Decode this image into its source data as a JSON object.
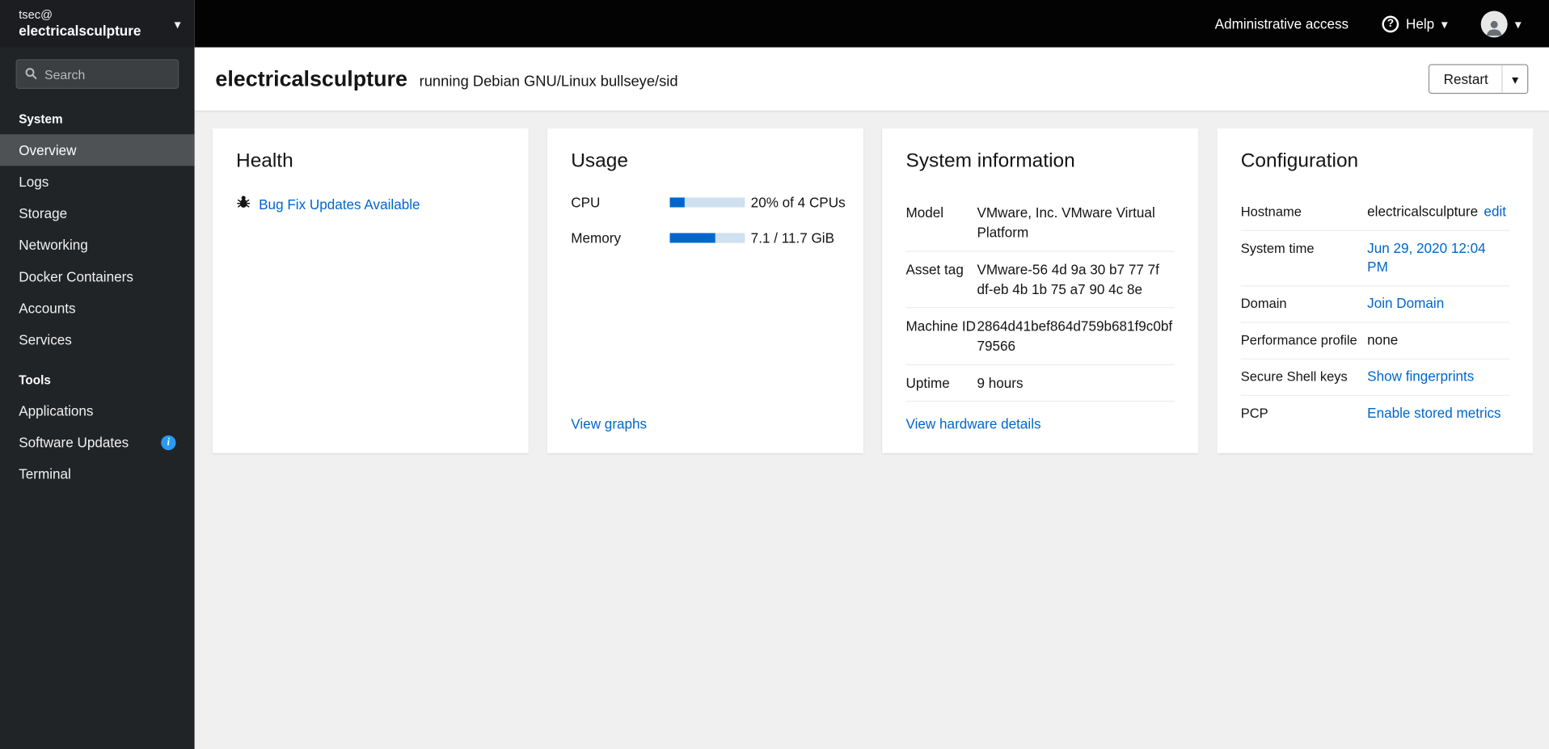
{
  "icons": {
    "caret": "▾",
    "question": "?",
    "info": "i"
  },
  "sidebar": {
    "user": "tsec@",
    "host": "electricalsculpture",
    "search_placeholder": "Search",
    "sections": [
      {
        "title": "System",
        "items": [
          {
            "label": "Overview"
          },
          {
            "label": "Logs"
          },
          {
            "label": "Storage"
          },
          {
            "label": "Networking"
          },
          {
            "label": "Docker Containers"
          },
          {
            "label": "Accounts"
          },
          {
            "label": "Services"
          }
        ]
      },
      {
        "title": "Tools",
        "items": [
          {
            "label": "Applications"
          },
          {
            "label": "Software Updates"
          },
          {
            "label": "Terminal"
          }
        ]
      }
    ]
  },
  "masthead": {
    "admin_access": "Administrative access",
    "help_label": "Help"
  },
  "header": {
    "hostname": "electricalsculpture",
    "os_text": "running Debian GNU/Linux bullseye/sid",
    "restart_label": "Restart"
  },
  "cards": {
    "health": {
      "title": "Health",
      "updates_link": "Bug Fix Updates Available"
    },
    "usage": {
      "title": "Usage",
      "cpu_label": "CPU",
      "cpu_percent": 20,
      "cpu_value": "20% of 4 CPUs",
      "memory_label": "Memory",
      "memory_percent": 61,
      "memory_value": "7.1 / 11.7 GiB",
      "view_graphs_link": "View graphs"
    },
    "system_information": {
      "title": "System information",
      "rows": [
        {
          "label": "Model",
          "value": "VMware, Inc. VMware Virtual Platform"
        },
        {
          "label": "Asset tag",
          "value": "VMware-56 4d 9a 30 b7 77 7f df-eb 4b 1b 75 a7 90 4c 8e"
        },
        {
          "label": "Machine ID",
          "value": "2864d41bef864d759b681f9c0bf79566"
        },
        {
          "label": "Uptime",
          "value": "9 hours"
        }
      ],
      "hardware_link": "View hardware details"
    },
    "configuration": {
      "title": "Configuration",
      "rows": [
        {
          "label": "Hostname",
          "value": "electricalsculpture",
          "link": "edit"
        },
        {
          "label": "System time",
          "value": "",
          "link": "Jun 29, 2020 12:04 PM"
        },
        {
          "label": "Domain",
          "value": "",
          "link": "Join Domain"
        },
        {
          "label": "Performance profile",
          "value": "none",
          "link": ""
        },
        {
          "label": "Secure Shell keys",
          "value": "",
          "link": "Show fingerprints"
        },
        {
          "label": "PCP",
          "value": "",
          "link": "Enable stored metrics"
        }
      ]
    }
  },
  "colors": {
    "accent_link": "#0066cc",
    "masthead_bg": "#030303",
    "sidebar_bg": "#212427",
    "active_nav_bg": "#4f5255",
    "progress_fill": "#0066cc",
    "progress_track": "#cfe0f0",
    "info_badge": "#2b9af3"
  }
}
